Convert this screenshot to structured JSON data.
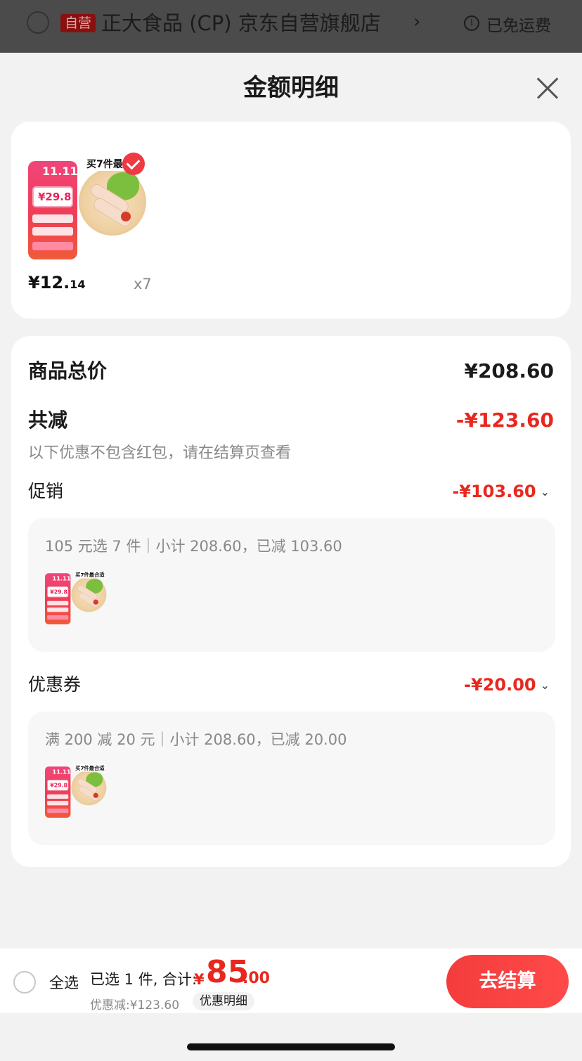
{
  "store_header": {
    "self_tag": "自营",
    "store_name": "正大食品 (CP) 京东自营旗舰店",
    "chevron": "›",
    "info_icon": "i",
    "shipping": "已免运费"
  },
  "sheet": {
    "title": "金额明细",
    "close_icon": "close-icon"
  },
  "product": {
    "promo_logo": "11.11",
    "promo_price": "¥29.8",
    "buy_tag": "买7件最",
    "price_int": "¥12.",
    "price_dec": "14",
    "quantity": "x7"
  },
  "summary": {
    "total_label": "商品总价",
    "total_value": "¥208.60",
    "reduce_label": "共减",
    "reduce_value": "-¥123.60",
    "note": "以下优惠不包含红包，请在结算页查看"
  },
  "sections": [
    {
      "label": "促销",
      "amount": "-¥103.60",
      "detail": "105 元选 7 件｜小计 208.60，已减 103.60",
      "promo_price": "¥29.8",
      "buy_tag": "买7件最合适"
    },
    {
      "label": "优惠券",
      "amount": "-¥20.00",
      "detail": "满 200 减 20 元｜小计 208.60，已减 20.00",
      "promo_price": "¥29.8",
      "buy_tag": "买7件最合适"
    }
  ],
  "bottom_bar": {
    "select_all": "全选",
    "selected_text": "已选 1 件, 合计:",
    "total_symbol": "¥",
    "total_int": "85",
    "total_dec": ".00",
    "discount_text": "优惠减:¥123.60",
    "detail_chip": "优惠明细",
    "checkout": "去结算"
  },
  "colors": {
    "accent_red": "#e8281f",
    "checkout_red": "#f43c3c"
  }
}
